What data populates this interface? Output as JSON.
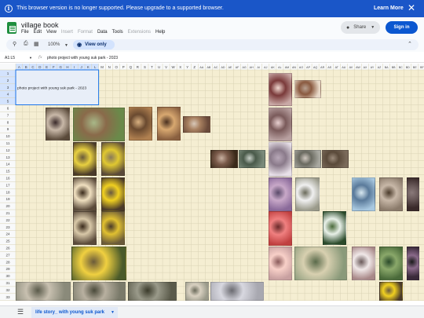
{
  "banner": {
    "info_icon": "info-icon",
    "message": "This browser version is no longer supported. Please upgrade to a supported browser.",
    "learn_more": "Learn More",
    "close": "✕"
  },
  "app": {
    "icon": "sheets-logo-icon",
    "title": "village book",
    "menus": [
      {
        "label": "File",
        "disabled": false
      },
      {
        "label": "Edit",
        "disabled": false
      },
      {
        "label": "View",
        "disabled": false
      },
      {
        "label": "Insert",
        "disabled": true
      },
      {
        "label": "Format",
        "disabled": true
      },
      {
        "label": "Data",
        "disabled": false
      },
      {
        "label": "Tools",
        "disabled": false
      },
      {
        "label": "Extensions",
        "disabled": true
      },
      {
        "label": "Help",
        "disabled": false
      }
    ],
    "share_label": "Share",
    "signin_label": "Sign in"
  },
  "toolbar": {
    "zoom": "100%",
    "view_only": "View only",
    "icons": [
      "search-icon",
      "print-icon",
      "paint-format-icon",
      "chevron-up-icon"
    ]
  },
  "formula_bar": {
    "cell_ref": "A1:L5",
    "fx": "fx",
    "content": "photo project with young suk park - 2023"
  },
  "grid": {
    "columns": [
      "A",
      "B",
      "C",
      "D",
      "E",
      "F",
      "G",
      "H",
      "I",
      "J",
      "K",
      "L",
      "M",
      "N",
      "O",
      "P",
      "Q",
      "R",
      "S",
      "T",
      "U",
      "V",
      "W",
      "X",
      "Y",
      "Z",
      "AA",
      "AB",
      "AC",
      "AD",
      "AE",
      "AF",
      "AG",
      "AH",
      "AI",
      "AJ",
      "AK",
      "AL",
      "AM",
      "AN",
      "AO",
      "AP",
      "AQ",
      "AR",
      "AS",
      "AT",
      "AU",
      "AV",
      "AW",
      "AX",
      "AY",
      "AZ",
      "BA",
      "BB",
      "BC",
      "BD",
      "BE",
      "BF"
    ],
    "rows": [
      "1",
      "2",
      "3",
      "4",
      "5",
      "6",
      "7",
      "8",
      "9",
      "10",
      "11",
      "12",
      "13",
      "14",
      "15",
      "16",
      "17",
      "18",
      "19",
      "20",
      "21",
      "22",
      "23",
      "24",
      "25",
      "26",
      "27",
      "28",
      "29",
      "30",
      "31",
      "32",
      "33"
    ],
    "merged_text": "photo project with young suk park - 2023",
    "photos": [
      {
        "name": "photo-portrait-pink",
        "colors": [
          "#c9a9a6",
          "#7a3a3a",
          "#f0d8d0"
        ]
      },
      {
        "name": "photo-plant-pot",
        "colors": [
          "#e8d9c8",
          "#8a5a40",
          "#b7a090"
        ]
      },
      {
        "name": "photo-woman-tree",
        "colors": [
          "#5a4a3a",
          "#c8b8a8",
          "#3a2a2a"
        ]
      },
      {
        "name": "photo-orchard",
        "colors": [
          "#6a8a4a",
          "#8a6a4a",
          "#a8b888"
        ]
      },
      {
        "name": "photo-dried-plant",
        "colors": [
          "#b08050",
          "#6a4a30",
          "#d8b080"
        ]
      },
      {
        "name": "photo-hand-glove",
        "colors": [
          "#8a6040",
          "#d8a870",
          "#4a3020"
        ]
      },
      {
        "name": "photo-soil-field",
        "colors": [
          "#6a4a3a",
          "#a88060",
          "#d8c8b8"
        ]
      },
      {
        "name": "photo-blurry-tree",
        "colors": [
          "#b8a0a0",
          "#7a5a5a",
          "#e8d0d0"
        ]
      },
      {
        "name": "photo-trees-one",
        "colors": [
          "#3a2a1a",
          "#7a5a4a",
          "#c8b0a0"
        ]
      },
      {
        "name": "photo-green-field",
        "colors": [
          "#7a8a7a",
          "#4a5a4a",
          "#c8d0c8"
        ]
      },
      {
        "name": "photo-white-blossoms",
        "colors": [
          "#e8e0e8",
          "#8a7a8a",
          "#b8a8b8"
        ]
      },
      {
        "name": "photo-fence",
        "colors": [
          "#a8a8a0",
          "#6a6a60",
          "#d0c8c0"
        ]
      },
      {
        "name": "photo-rocky-soil",
        "colors": [
          "#7a6a5a",
          "#5a4a3a",
          "#9a8a7a"
        ]
      },
      {
        "name": "photo-yellow-flower-a",
        "colors": [
          "#4a3a2a",
          "#e8d040",
          "#6a5a3a"
        ]
      },
      {
        "name": "photo-yellow-flower-b",
        "colors": [
          "#5a4a3a",
          "#e0c830",
          "#8a7a5a"
        ]
      },
      {
        "name": "photo-seedling-a",
        "colors": [
          "#5a4a3a",
          "#f0e0c0",
          "#3a2a1a"
        ]
      },
      {
        "name": "photo-yellow-flowers-c",
        "colors": [
          "#4a3a2a",
          "#f0d020",
          "#6a5a40"
        ]
      },
      {
        "name": "photo-purple-blur",
        "colors": [
          "#8a6a9a",
          "#c8a8c8",
          "#5a4a6a"
        ]
      },
      {
        "name": "photo-white-cross",
        "colors": [
          "#9a9a8a",
          "#f0f0f0",
          "#6a6a5a"
        ]
      },
      {
        "name": "photo-person-sky",
        "colors": [
          "#a8c8e0",
          "#5a7a9a",
          "#d8e8f0"
        ]
      },
      {
        "name": "photo-shovel",
        "colors": [
          "#8a7a6a",
          "#c8b8a8",
          "#4a3a2a"
        ]
      },
      {
        "name": "photo-dark-tree",
        "colors": [
          "#3a2a2a",
          "#6a5a5a",
          "#8a7a7a"
        ]
      },
      {
        "name": "photo-leaves-pink",
        "colors": [
          "#8a9a6a",
          "#d8a0a0",
          "#5a6a3a"
        ]
      },
      {
        "name": "photo-seedlings-b",
        "colors": [
          "#5a4a3a",
          "#d8c8a8",
          "#3a2a1a"
        ]
      },
      {
        "name": "photo-yellow-flowers-d",
        "colors": [
          "#6a5a3a",
          "#e0c030",
          "#4a3a2a"
        ]
      },
      {
        "name": "photo-red-flower",
        "colors": [
          "#c04040",
          "#f08080",
          "#6a2a2a"
        ]
      },
      {
        "name": "photo-white-flowers-green",
        "colors": [
          "#2a4a2a",
          "#e8f0e8",
          "#4a6a3a"
        ]
      },
      {
        "name": "photo-yellow-flowers-e",
        "colors": [
          "#4a5a2a",
          "#f0d040",
          "#6a5a3a"
        ]
      },
      {
        "name": "photo-bubble-macro",
        "colors": [
          "#c8a0a0",
          "#f8d0c8",
          "#8a5a5a"
        ]
      },
      {
        "name": "photo-bokeh-macro",
        "colors": [
          "#8a9a7a",
          "#d8d0b0",
          "#5a6a4a"
        ]
      },
      {
        "name": "photo-white-flower-pink",
        "colors": [
          "#a88888",
          "#f0e8e8",
          "#6a5a5a"
        ]
      },
      {
        "name": "photo-green-leaves",
        "colors": [
          "#4a6a3a",
          "#8aa86a",
          "#2a4a2a"
        ]
      },
      {
        "name": "photo-dark-flower",
        "colors": [
          "#3a2a3a",
          "#8a6a8a",
          "#1a1a1a"
        ]
      },
      {
        "name": "photo-field-a",
        "colors": [
          "#8a8a7a",
          "#c8c0b0",
          "#5a5a4a"
        ]
      },
      {
        "name": "photo-field-b",
        "colors": [
          "#7a7a6a",
          "#b8b0a0",
          "#4a4a3a"
        ]
      },
      {
        "name": "photo-field-c",
        "colors": [
          "#5a5a4a",
          "#9a9a8a",
          "#3a3a2a"
        ]
      },
      {
        "name": "photo-field-d",
        "colors": [
          "#9a9a8a",
          "#d8d0c0",
          "#6a6a5a"
        ]
      },
      {
        "name": "photo-river",
        "colors": [
          "#a8a8b0",
          "#d8d8e0",
          "#6a6a70"
        ]
      }
    ]
  },
  "bottom": {
    "sheets_menu_icon": "all-sheets-menu-icon",
    "sheet_tab": "life story_ with young suk park"
  }
}
